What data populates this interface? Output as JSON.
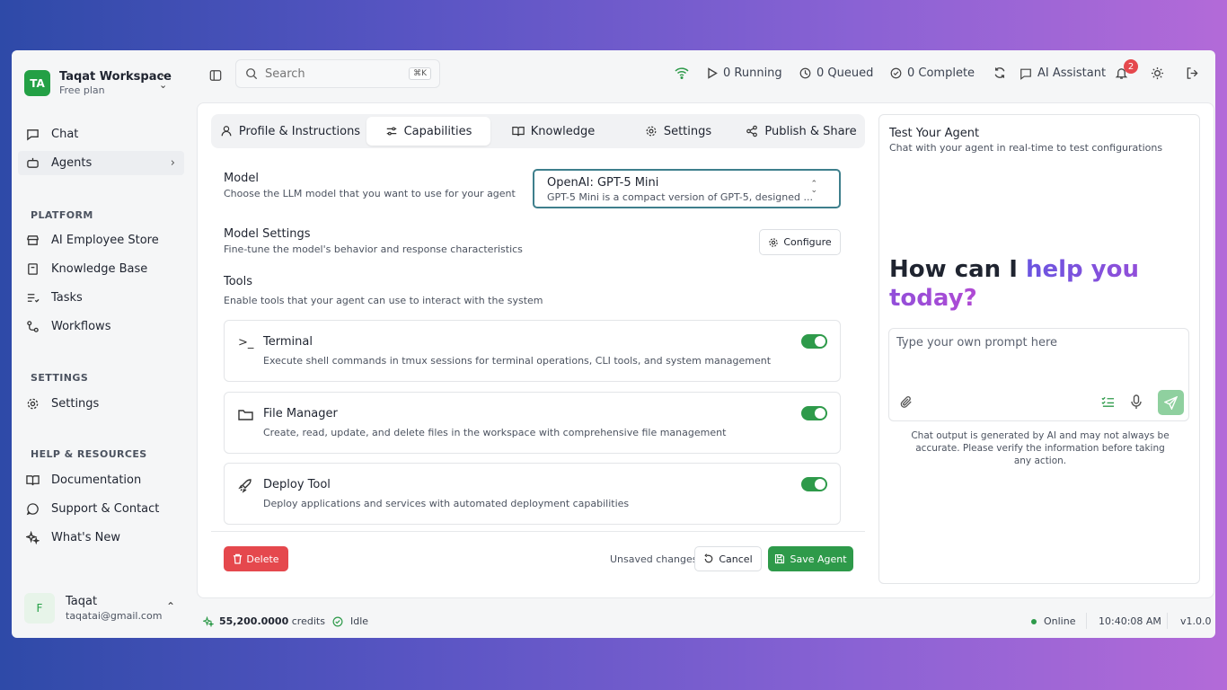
{
  "workspace": {
    "initials": "TA",
    "name": "Taqat Workspace",
    "plan": "Free plan"
  },
  "nav": {
    "chat": "Chat",
    "agents": "Agents",
    "platform_title": "PLATFORM",
    "platform": [
      "AI Employee Store",
      "Knowledge Base",
      "Tasks",
      "Workflows"
    ],
    "settings_title": "SETTINGS",
    "settings": "Settings",
    "help_title": "HELP & RESOURCES",
    "help": [
      "Documentation",
      "Support & Contact",
      "What's New"
    ]
  },
  "user": {
    "initial": "F",
    "name": "Taqat",
    "email": "taqatai@gmail.com"
  },
  "topbar": {
    "search_placeholder": "Search",
    "search_shortcut": "⌘K",
    "running": "0 Running",
    "queued": "0 Queued",
    "complete": "0 Complete",
    "assistant": "AI Assistant",
    "notifications": "2"
  },
  "tabs": [
    "Profile & Instructions",
    "Capabilities",
    "Knowledge",
    "Settings",
    "Publish & Share"
  ],
  "model": {
    "title": "Model",
    "subtitle": "Choose the LLM model that you want to use for your agent",
    "selected": "OpenAI: GPT-5 Mini",
    "description": "GPT-5 Mini is a compact version of GPT-5, designed ..."
  },
  "model_settings": {
    "title": "Model Settings",
    "subtitle": "Fine-tune the model's behavior and response characteristics",
    "configure": "Configure"
  },
  "tools": {
    "title": "Tools",
    "subtitle": "Enable tools that your agent can use to interact with the system",
    "items": [
      {
        "name": "Terminal",
        "desc": "Execute shell commands in tmux sessions for terminal operations, CLI tools, and system management",
        "icon": "terminal-icon",
        "enabled": true
      },
      {
        "name": "File Manager",
        "desc": "Create, read, update, and delete files in the workspace with comprehensive file management",
        "icon": "folder-icon",
        "enabled": true
      },
      {
        "name": "Deploy Tool",
        "desc": "Deploy applications and services with automated deployment capabilities",
        "icon": "rocket-icon",
        "enabled": true
      }
    ]
  },
  "actions": {
    "delete": "Delete",
    "unsaved": "Unsaved changes",
    "cancel": "Cancel",
    "save": "Save Agent"
  },
  "test": {
    "title": "Test Your Agent",
    "subtitle": "Chat with your agent in real-time to test configurations",
    "hero_plain": "How can I ",
    "hero_accent": "help you today?",
    "prompt_placeholder": "Type your own prompt here",
    "disclaimer": "Chat output is generated by AI and may not always be accurate. Please verify the information before taking any action."
  },
  "status": {
    "credits_value": "55,200.0000",
    "credits_label": "credits",
    "state": "Idle",
    "online": "Online",
    "time": "10:40:08 AM",
    "version": "v1.0.0"
  },
  "colors": {
    "accent_green": "#2e9a4a",
    "danger": "#e5484d",
    "brand": "#23a045"
  }
}
